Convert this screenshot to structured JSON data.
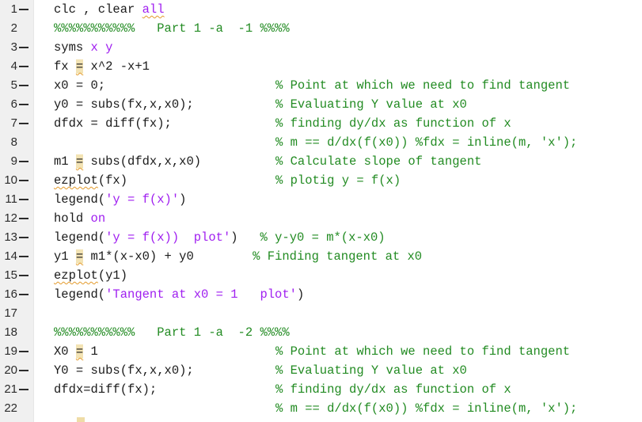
{
  "editor": {
    "lines": [
      {
        "num": "1",
        "marker": true,
        "parts": [
          {
            "t": "clc , clear ",
            "c": "plain"
          },
          {
            "t": "all",
            "c": "kw-squig"
          }
        ],
        "comment": ""
      },
      {
        "num": "2",
        "marker": false,
        "parts": [
          {
            "t": "%%%%%%%%%%%   Part 1 -a  -1 %%%%",
            "c": "cm"
          }
        ],
        "comment": ""
      },
      {
        "num": "3",
        "marker": true,
        "parts": [
          {
            "t": "syms ",
            "c": "plain"
          },
          {
            "t": "x y",
            "c": "kw"
          }
        ],
        "comment": ""
      },
      {
        "num": "4",
        "marker": true,
        "parts": [
          {
            "t": "fx ",
            "c": "plain"
          },
          {
            "t": "=",
            "c": "hl-squig"
          },
          {
            "t": " x^2 -x+1",
            "c": "plain"
          }
        ],
        "comment": ""
      },
      {
        "num": "5",
        "marker": true,
        "parts": [
          {
            "t": "x0 = 0;",
            "c": "plain"
          }
        ],
        "comment": "% Point at which we need to find tangent"
      },
      {
        "num": "6",
        "marker": true,
        "parts": [
          {
            "t": "y0 = subs(fx,x,x0);",
            "c": "plain"
          }
        ],
        "comment": "% Evaluating Y value at x0"
      },
      {
        "num": "7",
        "marker": true,
        "parts": [
          {
            "t": "dfdx = diff(fx);",
            "c": "plain"
          }
        ],
        "comment": "% finding dy/dx as function of x"
      },
      {
        "num": "8",
        "marker": false,
        "parts": [],
        "comment": "% m == d/dx(f(x0)) %fdx = inline(m, 'x');"
      },
      {
        "num": "9",
        "marker": true,
        "parts": [
          {
            "t": "m1 ",
            "c": "plain"
          },
          {
            "t": "=",
            "c": "hl-squig"
          },
          {
            "t": " subs(dfdx,x,x0)",
            "c": "plain"
          }
        ],
        "comment": "% Calculate slope of tangent"
      },
      {
        "num": "10",
        "marker": true,
        "parts": [
          {
            "t": "ezplot",
            "c": "squig"
          },
          {
            "t": "(fx)",
            "c": "plain"
          }
        ],
        "comment": "% plotig y = f(x)"
      },
      {
        "num": "11",
        "marker": true,
        "parts": [
          {
            "t": "legend(",
            "c": "plain"
          },
          {
            "t": "'y = f(x)'",
            "c": "str"
          },
          {
            "t": ")",
            "c": "plain"
          }
        ],
        "comment": ""
      },
      {
        "num": "12",
        "marker": true,
        "parts": [
          {
            "t": "hold ",
            "c": "plain"
          },
          {
            "t": "on",
            "c": "kw"
          }
        ],
        "comment": ""
      },
      {
        "num": "13",
        "marker": true,
        "parts": [
          {
            "t": "legend(",
            "c": "plain"
          },
          {
            "t": "'y = f(x))  plot'",
            "c": "str"
          },
          {
            "t": ")",
            "c": "plain"
          },
          {
            "t": "   % y-y0 = m*(x-x0)",
            "c": "cm"
          }
        ],
        "comment": ""
      },
      {
        "num": "14",
        "marker": true,
        "parts": [
          {
            "t": "y1 ",
            "c": "plain"
          },
          {
            "t": "=",
            "c": "hl-squig"
          },
          {
            "t": " m1*(x-x0) + y0",
            "c": "plain"
          },
          {
            "t": "        % Finding tangent at x0",
            "c": "cm"
          }
        ],
        "comment": ""
      },
      {
        "num": "15",
        "marker": true,
        "parts": [
          {
            "t": "ezplot",
            "c": "squig"
          },
          {
            "t": "(y1)",
            "c": "plain"
          }
        ],
        "comment": ""
      },
      {
        "num": "16",
        "marker": true,
        "parts": [
          {
            "t": "legend(",
            "c": "plain"
          },
          {
            "t": "'Tangent at x0 = 1   plot'",
            "c": "str"
          },
          {
            "t": ")",
            "c": "plain"
          }
        ],
        "comment": ""
      },
      {
        "num": "17",
        "marker": false,
        "parts": [],
        "comment": ""
      },
      {
        "num": "18",
        "marker": false,
        "parts": [
          {
            "t": "%%%%%%%%%%%   Part 1 -a  -2 %%%%",
            "c": "cm"
          }
        ],
        "comment": ""
      },
      {
        "num": "19",
        "marker": true,
        "parts": [
          {
            "t": "X0 ",
            "c": "plain"
          },
          {
            "t": "=",
            "c": "hl-squig"
          },
          {
            "t": " 1",
            "c": "plain"
          }
        ],
        "comment": "% Point at which we need to find tangent"
      },
      {
        "num": "20",
        "marker": true,
        "parts": [
          {
            "t": "Y0 = subs(fx,x,x0);",
            "c": "plain"
          }
        ],
        "comment": "% Evaluating Y value at x0"
      },
      {
        "num": "21",
        "marker": true,
        "parts": [
          {
            "t": "dfdx=diff(fx);",
            "c": "plain"
          }
        ],
        "comment": "% finding dy/dx as function of x"
      },
      {
        "num": "22",
        "marker": false,
        "parts": [],
        "comment": "% m == d/dx(f(x0)) %fdx = inline(m, 'x');"
      }
    ]
  }
}
